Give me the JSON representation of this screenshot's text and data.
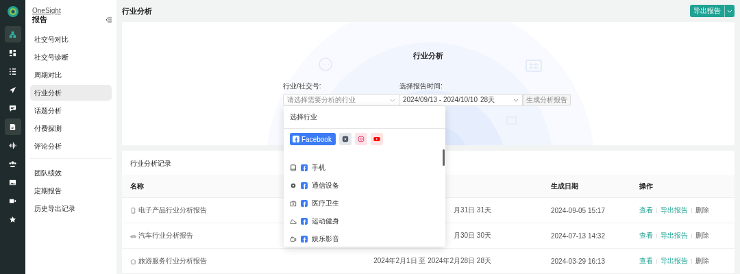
{
  "rail": {
    "items": [
      {
        "kind": "org",
        "selected": true
      },
      {
        "kind": "dashboard",
        "selected": false
      },
      {
        "kind": "list",
        "selected": false
      },
      {
        "kind": "send",
        "selected": false
      },
      {
        "kind": "chat",
        "selected": false
      },
      {
        "kind": "report",
        "selected": true
      },
      {
        "kind": "audio",
        "selected": false
      },
      {
        "kind": "team",
        "selected": false
      },
      {
        "kind": "image",
        "selected": false
      },
      {
        "kind": "video",
        "selected": false
      },
      {
        "kind": "star",
        "selected": false
      }
    ]
  },
  "sidebar": {
    "brand": "OneSight",
    "title": "报告",
    "groups": [
      [
        {
          "label": "社交号对比",
          "selected": false
        },
        {
          "label": "社交号诊断",
          "selected": false
        },
        {
          "label": "周期对比",
          "selected": false
        },
        {
          "label": "行业分析",
          "selected": true
        },
        {
          "label": "话题分析",
          "selected": false
        },
        {
          "label": "付费探测",
          "selected": false
        },
        {
          "label": "评论分析",
          "selected": false
        }
      ],
      [
        {
          "label": "团队绩效",
          "selected": false
        },
        {
          "label": "定期报告",
          "selected": false
        },
        {
          "label": "历史导出记录",
          "selected": false
        }
      ]
    ]
  },
  "header": {
    "title": "行业分析",
    "export_button": "导出报告"
  },
  "form": {
    "title": "行业分析",
    "industry_label": "行业/社交号:",
    "industry_placeholder": "请选择需要分析的行业",
    "date_label": "选择报告时间:",
    "date_value": "2024/09/13 - 2024/10/10",
    "date_days": "28天",
    "generate_button": "生成分析报告",
    "generate_disabled": true
  },
  "dropdown": {
    "title": "选择行业",
    "platforms": [
      {
        "kind": "facebook",
        "label": "Facebook",
        "selected": true
      },
      {
        "kind": "x",
        "selected": false
      },
      {
        "kind": "instagram",
        "selected": false
      },
      {
        "kind": "youtube",
        "selected": false
      }
    ],
    "items": [
      {
        "kind": "phone",
        "label": "手机"
      },
      {
        "kind": "network",
        "label": "通信设备"
      },
      {
        "kind": "medical",
        "label": "医疗卫生"
      },
      {
        "kind": "sport",
        "label": "运动健身"
      },
      {
        "kind": "media",
        "label": "娱乐影音"
      }
    ]
  },
  "records": {
    "title": "行业分析记录",
    "columns": [
      "名称",
      "生成日期",
      "操作"
    ],
    "rows": [
      {
        "kind": "phone",
        "name": "电子产品行业分析报告",
        "period": "月31日 31天",
        "date": "2024-09-05 15:17",
        "actions": [
          {
            "label": "查看",
            "kind": "primary"
          },
          {
            "label": "导出报告",
            "kind": "primary"
          },
          {
            "label": "删除",
            "kind": "plain"
          }
        ]
      },
      {
        "kind": "car",
        "name": "汽车行业分析报告",
        "period": "月30日 30天",
        "date": "2024-07-13 14:32",
        "actions": [
          {
            "label": "查看",
            "kind": "primary"
          },
          {
            "label": "导出报告",
            "kind": "primary"
          },
          {
            "label": "删除",
            "kind": "plain"
          }
        ]
      },
      {
        "kind": "home",
        "name": "旅游服务行业分析报告",
        "period": "2024年2月1日 至 2024年2月28日 28天",
        "date": "2024-03-29 16:13",
        "actions": [
          {
            "label": "查看",
            "kind": "primary"
          },
          {
            "label": "导出报告",
            "kind": "primary"
          },
          {
            "label": "删除",
            "kind": "plain"
          }
        ]
      }
    ]
  }
}
